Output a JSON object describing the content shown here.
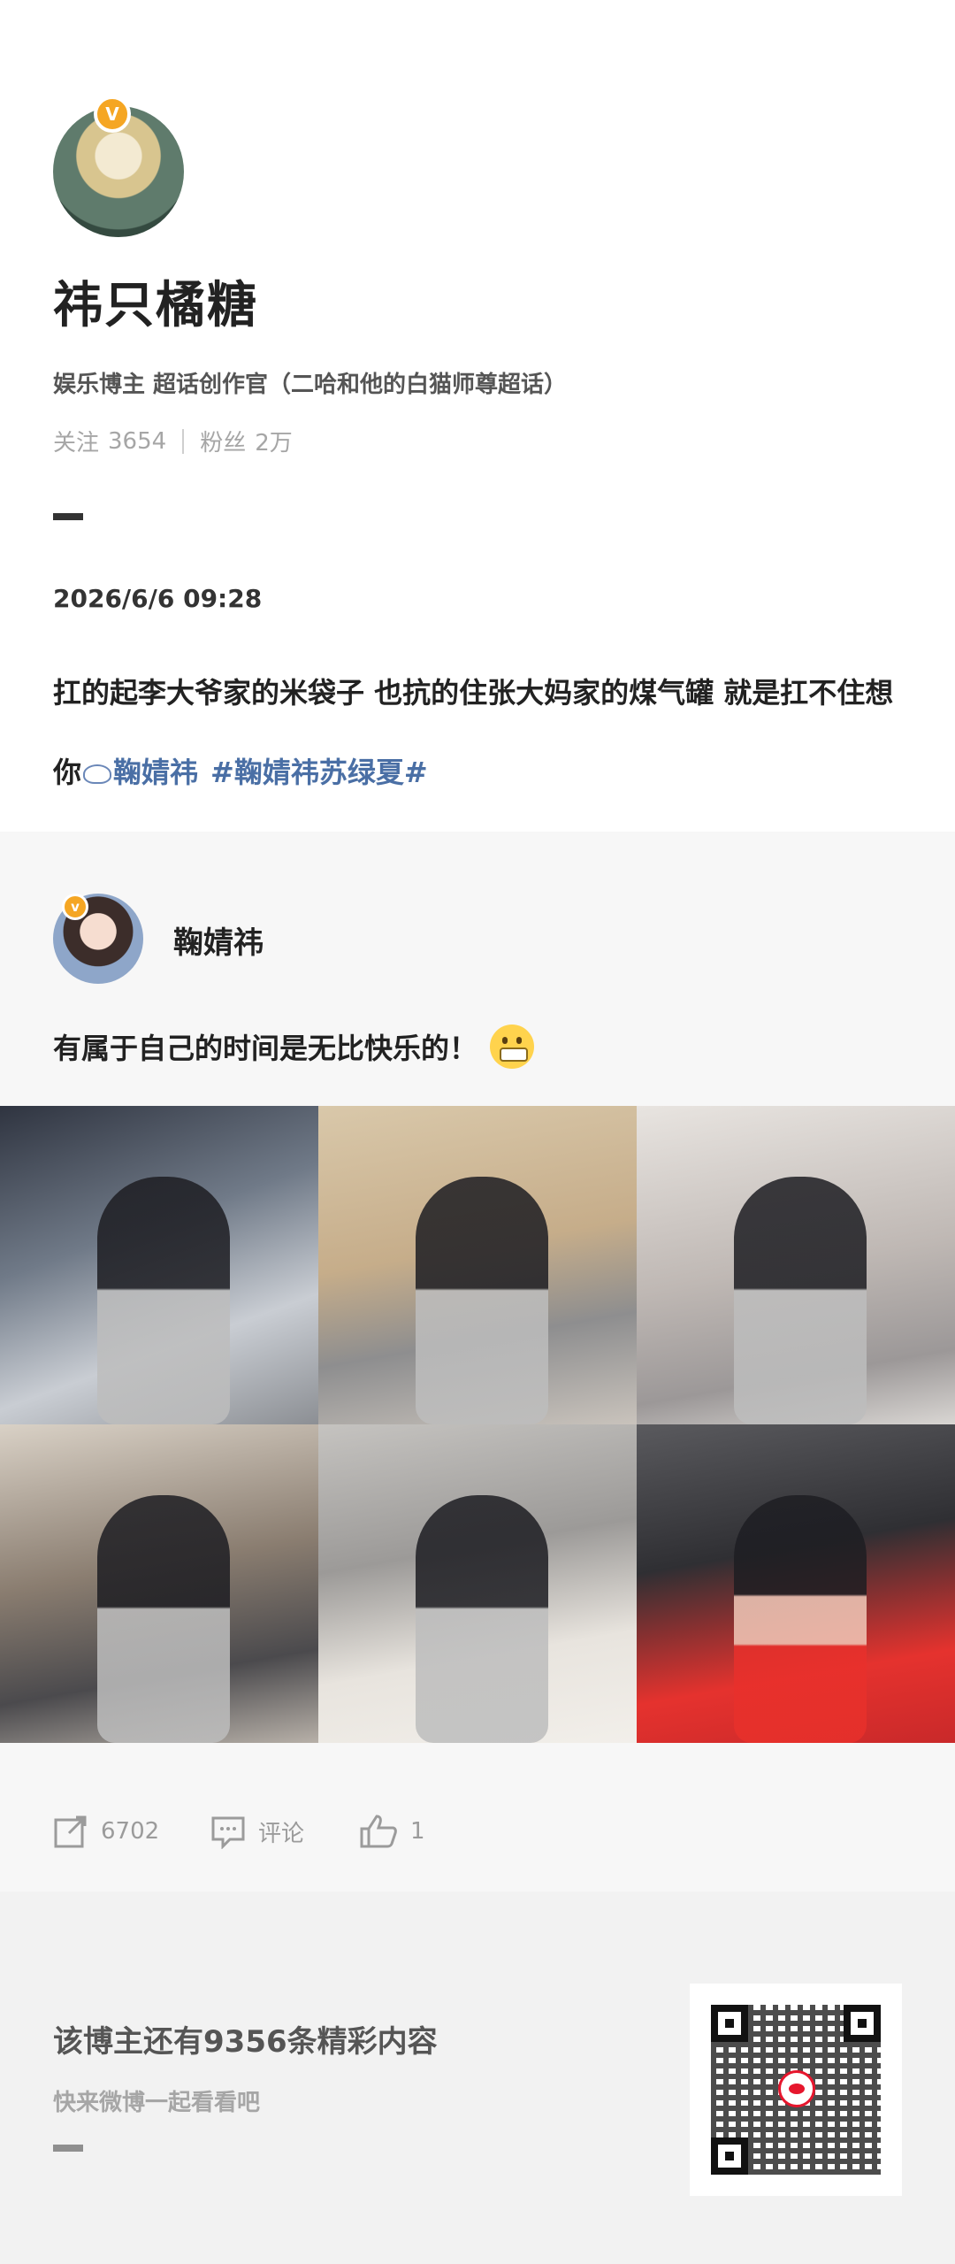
{
  "profile": {
    "name": "祎只橘糖",
    "intro": "娱乐博主  超话创作官（二哈和他的白猫师尊超话）",
    "following_label": "关注",
    "following_count": "3654",
    "followers_label": "粉丝",
    "followers_count": "2万",
    "verified_mark": "V"
  },
  "post": {
    "datetime": "2026/6/6 09:28",
    "text_part": "扛的起李大爷家的米袋子 也抗的住张大妈家的煤气罐 就是扛不住想你",
    "mention": "鞠婧祎",
    "topic": "#鞠婧祎苏绿夏#"
  },
  "repost": {
    "author": "鞠婧祎",
    "verified_mark": "v",
    "text": "有属于自己的时间是无比快乐的！",
    "emoji": "grimacing-face",
    "photos": [
      "bookstore-photo-1",
      "bookstore-photo-2",
      "bookstore-photo-3",
      "bookstore-photo-4",
      "car-selfie-photo-5",
      "car-selfie-photo-6"
    ]
  },
  "actions": {
    "share_count": "6702",
    "comment_label": "评论",
    "like_count": "1"
  },
  "footer": {
    "title": "该博主还有9356条精彩内容",
    "subtitle": "快来微博一起看看吧",
    "qr_icon": "weibo-qr-code"
  },
  "colors": {
    "link": "#4a6fa5",
    "badge": "#f5a623",
    "section_bg": "#f7f7f7"
  }
}
